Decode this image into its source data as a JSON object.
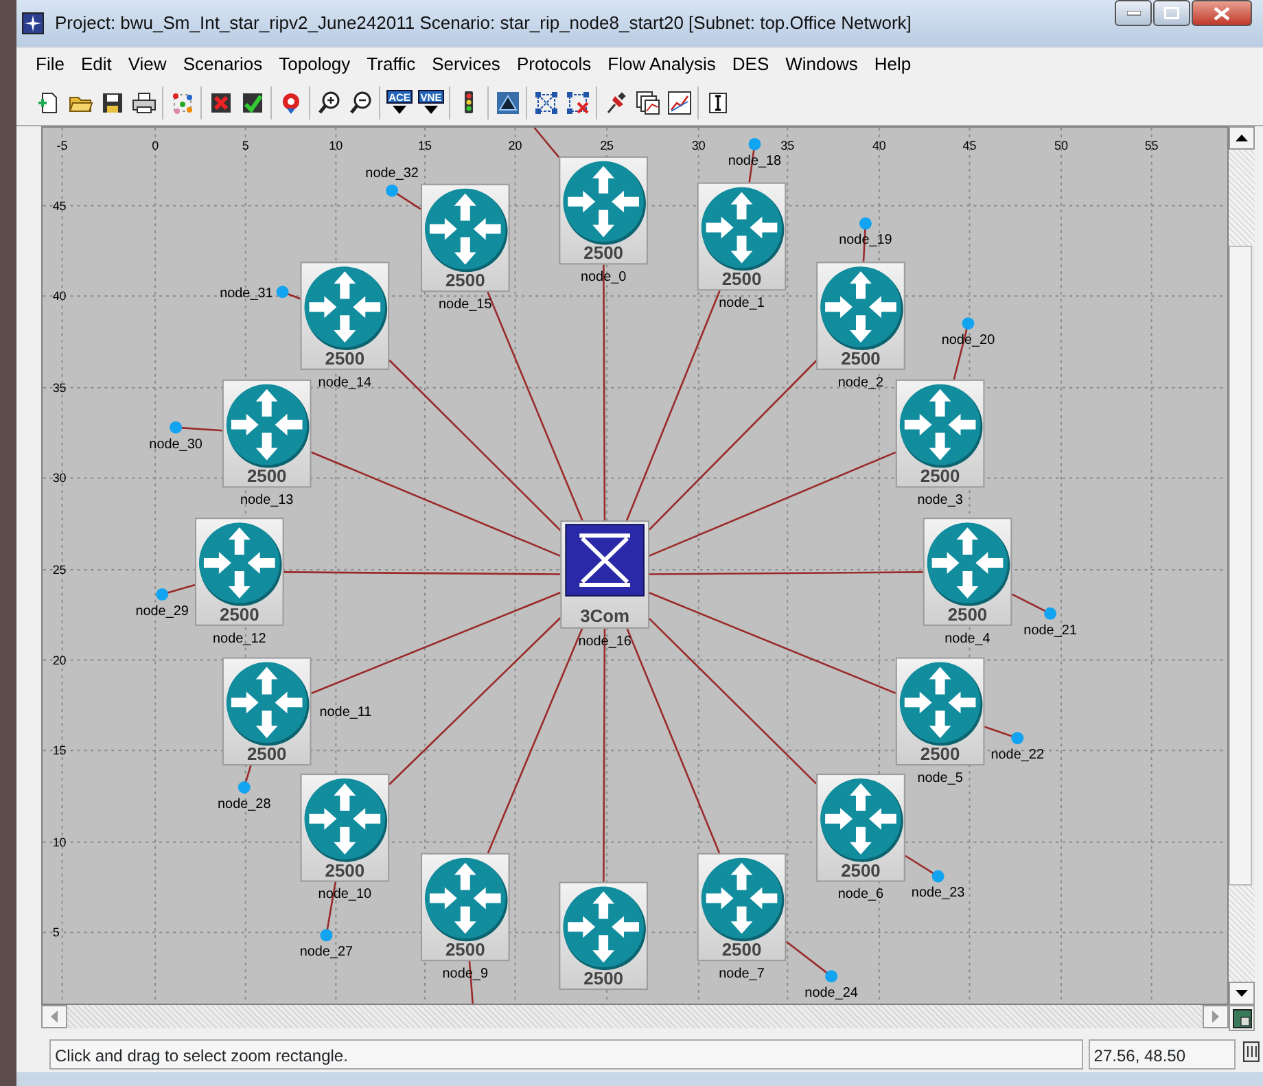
{
  "window": {
    "title": "Project: bwu_Sm_Int_star_ripv2_June242011 Scenario: star_rip_node8_start20  [Subnet: top.Office Network]"
  },
  "menu": [
    "File",
    "Edit",
    "View",
    "Scenarios",
    "Topology",
    "Traffic",
    "Services",
    "Protocols",
    "Flow Analysis",
    "DES",
    "Windows",
    "Help"
  ],
  "toolbar": {
    "badges": [
      "ACE",
      "VNE"
    ]
  },
  "rulers": {
    "x_ticks": [
      "-5",
      "0",
      "5",
      "10",
      "15",
      "20",
      "25",
      "30",
      "35",
      "40",
      "45",
      "50",
      "55"
    ],
    "y_ticks": [
      "45",
      "40",
      "35",
      "30",
      "25",
      "20",
      "15",
      "10",
      "5"
    ]
  },
  "switch": {
    "model": "3Com",
    "label": "node_16"
  },
  "routers": [
    {
      "label": "node_0",
      "model": "2500"
    },
    {
      "label": "node_15",
      "model": "2500"
    },
    {
      "label": "node_1",
      "model": "2500"
    },
    {
      "label": "node_14",
      "model": "2500"
    },
    {
      "label": "node_2",
      "model": "2500"
    },
    {
      "label": "node_13",
      "model": "2500"
    },
    {
      "label": "node_3",
      "model": "2500"
    },
    {
      "label": "node_12",
      "model": "2500"
    },
    {
      "label": "node_4",
      "model": "2500"
    },
    {
      "label": "node_11",
      "model": "2500"
    },
    {
      "label": "node_5",
      "model": "2500"
    },
    {
      "label": "node_10",
      "model": "2500"
    },
    {
      "label": "node_6",
      "model": "2500"
    },
    {
      "label": "node_9",
      "model": "2500"
    },
    {
      "model": "2500"
    },
    {
      "label": "node_7",
      "model": "2500"
    }
  ],
  "hosts": [
    {
      "label": "node_18"
    },
    {
      "label": "node_32"
    },
    {
      "label": "node_19"
    },
    {
      "label": "node_31"
    },
    {
      "label": "node_20"
    },
    {
      "label": "node_30"
    },
    {
      "label": "node_29"
    },
    {
      "label": "node_21"
    },
    {
      "label": "node_22"
    },
    {
      "label": "node_28"
    },
    {
      "label": "node_23"
    },
    {
      "label": "node_27"
    },
    {
      "label": "node_24"
    }
  ],
  "status_bar": {
    "message": "Click and drag to select zoom rectangle.",
    "coordinates": "27.56, 48.50"
  }
}
